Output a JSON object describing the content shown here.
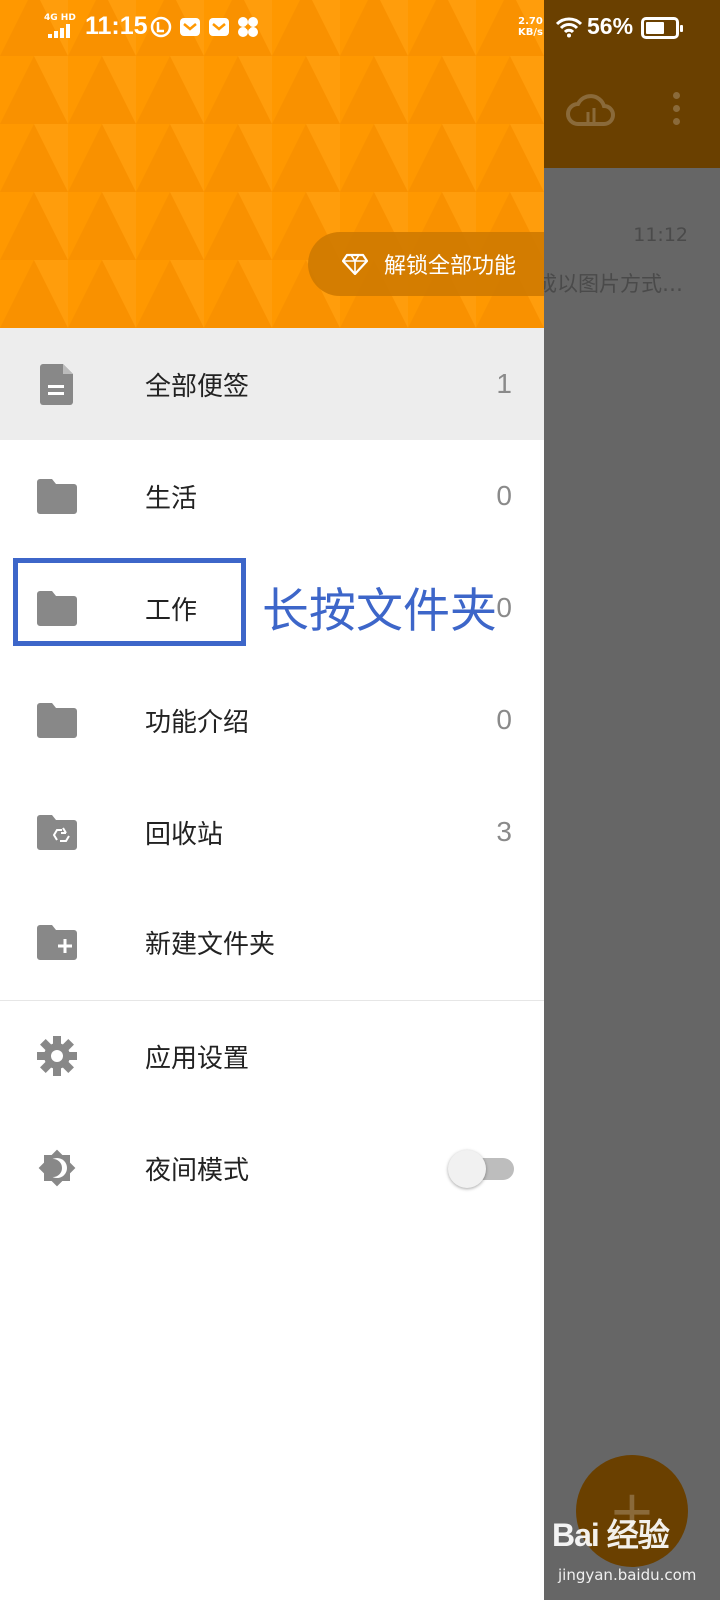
{
  "status_bar": {
    "network": "4G HD",
    "time": "11:15",
    "speed_value": "2.70",
    "speed_unit": "KB/s",
    "battery_percent": "56%",
    "battery_level": 0.56
  },
  "background_app": {
    "note_time": "11:12",
    "note_preview": "成以图片方式…",
    "fab_symbol": "+"
  },
  "drawer": {
    "header_color": "#ff9800",
    "unlock_button": {
      "label": "解锁全部功能",
      "icon": "diamond-icon"
    },
    "items": [
      {
        "label": "全部便签",
        "count": "1",
        "icon": "note-icon",
        "active": true
      },
      {
        "label": "生活",
        "count": "0",
        "icon": "folder-icon"
      },
      {
        "label": "工作",
        "count": "0",
        "icon": "folder-icon"
      },
      {
        "label": "功能介绍",
        "count": "0",
        "icon": "folder-icon"
      },
      {
        "label": "回收站",
        "count": "3",
        "icon": "recycle-folder-icon"
      },
      {
        "label": "新建文件夹",
        "count": "",
        "icon": "add-folder-icon"
      }
    ],
    "settings": [
      {
        "label": "应用设置",
        "icon": "gear-icon"
      },
      {
        "label": "夜间模式",
        "icon": "night-mode-icon",
        "toggle_on": false
      }
    ]
  },
  "annotation": {
    "text": "长按文件夹",
    "color": "#3d66c9"
  },
  "watermark": {
    "logo": "Bai 经验",
    "url": "jingyan.baidu.com"
  }
}
